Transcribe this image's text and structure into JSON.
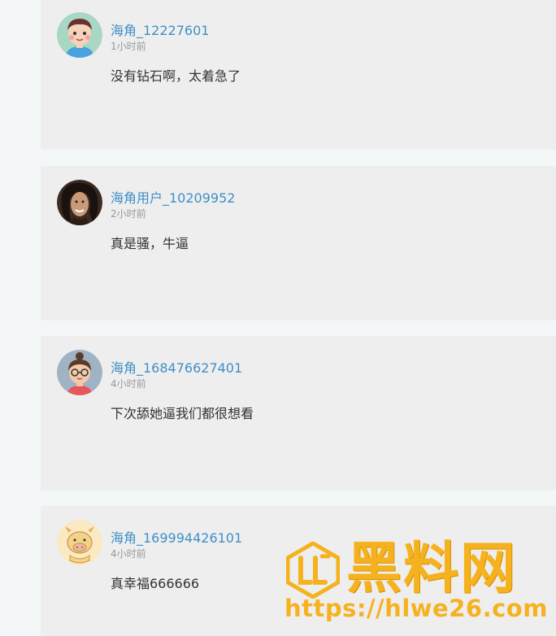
{
  "comments": [
    {
      "username": "海角_12227601",
      "time": "1小时前",
      "text": "没有钻石啊，太着急了",
      "avatar": "cartoon-boy-icon"
    },
    {
      "username": "海角用户_10209952",
      "time": "2小时前",
      "text": "真是骚，牛逼",
      "avatar": "photo-portrait-icon"
    },
    {
      "username": "海角_168476627401",
      "time": "4小时前",
      "text": "下次舔她逼我们都很想看",
      "avatar": "cartoon-girl-glasses-icon"
    },
    {
      "username": "海角_169994426101",
      "time": "4小时前",
      "text": "真幸福666666",
      "avatar": "cartoon-cow-icon"
    }
  ],
  "watermark": {
    "title": "黑料网",
    "url": "https://hlwe26.com",
    "color": "#f6b21e"
  },
  "colors": {
    "page_background": "#f4f7f8",
    "card_background": "#eeeeee",
    "username": "#3f8fc6",
    "timestamp": "#999999",
    "text": "#333333"
  }
}
